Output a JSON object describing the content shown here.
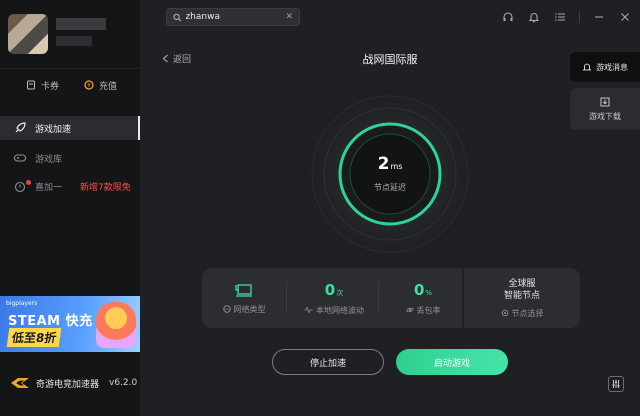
{
  "sidebar": {
    "quick_actions": [
      {
        "label": "卡券",
        "icon": "card-icon"
      },
      {
        "label": "充值",
        "icon": "coin-icon"
      }
    ],
    "nav": [
      {
        "label": "游戏加速",
        "icon": "rocket-icon",
        "active": true
      },
      {
        "label": "游戏库",
        "icon": "gamepad-icon",
        "active": false
      },
      {
        "label": "喜加一",
        "icon": "gift-icon",
        "active": false,
        "extra": "新增7款限免"
      }
    ],
    "banner": {
      "tag": "bigplayers",
      "title": "STEAM 快充",
      "subtitle": "低至8折"
    },
    "brand": {
      "name": "奇游电竞加速器",
      "version": "v6.2.0"
    }
  },
  "topbar": {
    "search_value": "zhanwa",
    "icons": [
      "headset-icon",
      "bell-icon",
      "menu-icon",
      "minimize-icon",
      "close-icon"
    ]
  },
  "main": {
    "back_label": "返回",
    "game_title": "战网国际服",
    "side_tabs": [
      {
        "label": "游戏消息",
        "icon": "bell-icon"
      },
      {
        "label": "游戏下载",
        "icon": "download-icon"
      }
    ],
    "latency": {
      "value": "2",
      "unit": "ms",
      "label": "节点延迟"
    },
    "stats": {
      "network_type_label": "网络类型",
      "jitter": {
        "value": "0",
        "unit": "次",
        "label": "本地网络波动"
      },
      "packet_loss": {
        "value": "0",
        "unit": "%",
        "label": "丢包率"
      },
      "node": {
        "line1": "全球服",
        "line2": "智能节点",
        "label": "节点选择"
      }
    },
    "buttons": {
      "stop": "停止加速",
      "start": "启动游戏"
    }
  },
  "colors": {
    "accent": "#3ee0a1",
    "sidebar_bg": "#141517",
    "main_bg": "#1f2023",
    "alert": "#ff4f4f"
  }
}
